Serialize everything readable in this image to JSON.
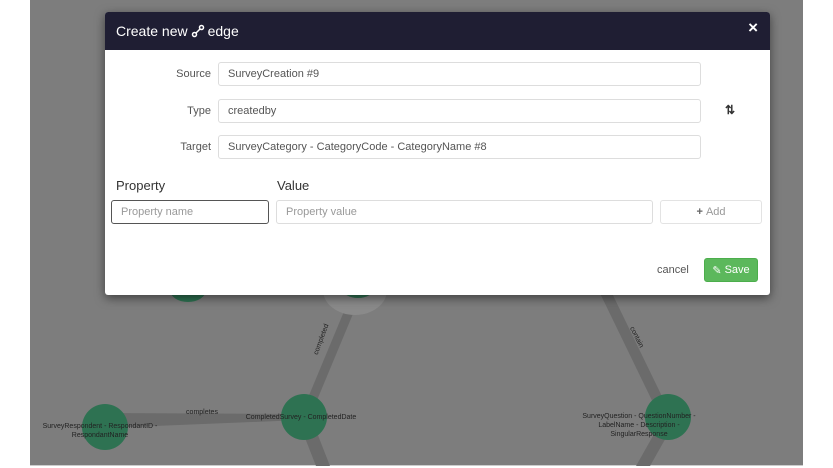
{
  "dialog": {
    "title_prefix": "Create new",
    "title_suffix": "edge",
    "close": "×"
  },
  "form": {
    "source_label": "Source",
    "source_value": "SurveyCreation #9",
    "type_label": "Type",
    "type_value": "createdby",
    "target_label": "Target",
    "target_value": "SurveyCategory - CategoryCode - CategoryName #8",
    "swap_icon": "⇅"
  },
  "properties": {
    "property_header": "Property",
    "value_header": "Value",
    "name_placeholder": "Property name",
    "value_placeholder": "Property value",
    "add_label": "Add"
  },
  "footer": {
    "cancel": "cancel",
    "save": "Save"
  },
  "graph": {
    "nodes": [
      {
        "label1": "SurveyRespondent - RespondantID -",
        "label2": "RespondantName"
      },
      {
        "label1": "CompletedSurvey - CompletedDate",
        "label2": ""
      },
      {
        "label1": "SurveyQuestion - QuestionNumber -",
        "label2": "LabelName - Description -",
        "label3": "SingularResponse"
      }
    ],
    "edges": {
      "completes": "completes",
      "completed": "completed",
      "contain": "contain"
    },
    "colors": {
      "node": "#2e7252",
      "edge": "#6a6a6a"
    }
  }
}
